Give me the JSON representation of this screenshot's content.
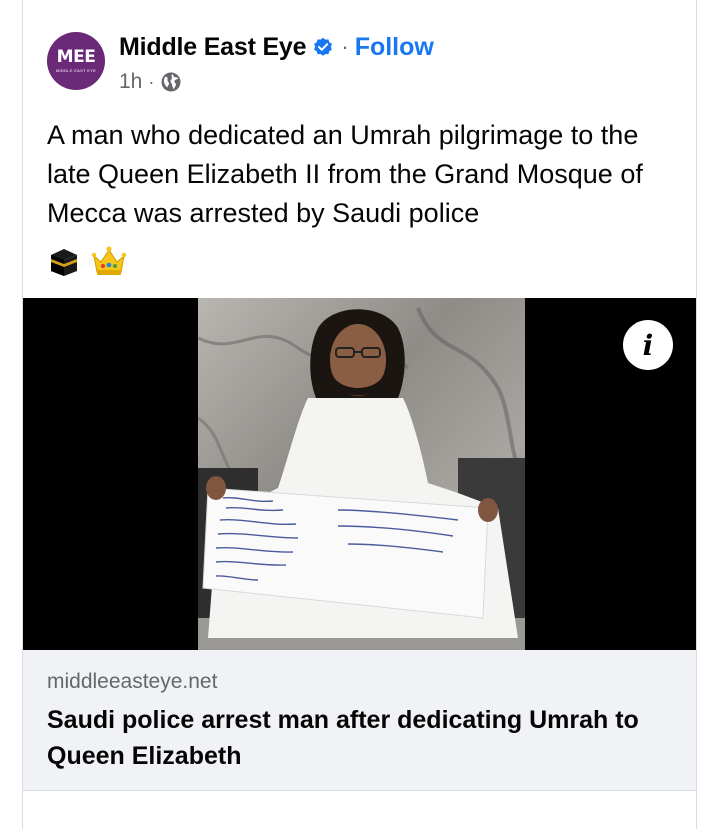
{
  "post": {
    "author": "Middle East Eye",
    "avatar_initials": "MEE",
    "avatar_subtext": "MIDDLE EAST EYE",
    "verified_icon": "verified-badge-icon",
    "separator": "·",
    "follow_label": "Follow",
    "time": "1h",
    "audience_icon": "globe-icon",
    "text": "A man who dedicated an Umrah pilgrimage to the late Queen Elizabeth II from the Grand Mosque of Mecca was arrested by Saudi police",
    "emojis": [
      "kaaba-emoji",
      "crown-emoji"
    ]
  },
  "link_preview": {
    "domain": "middleeasteye.net",
    "headline": "Saudi police arrest man after dedicating Umrah to Queen Elizabeth",
    "info_label": "i"
  },
  "colors": {
    "brand_purple": "#6a2a78",
    "follow_blue": "#1877f2",
    "muted_text": "#65676b",
    "preview_bg": "#f0f2f5"
  }
}
